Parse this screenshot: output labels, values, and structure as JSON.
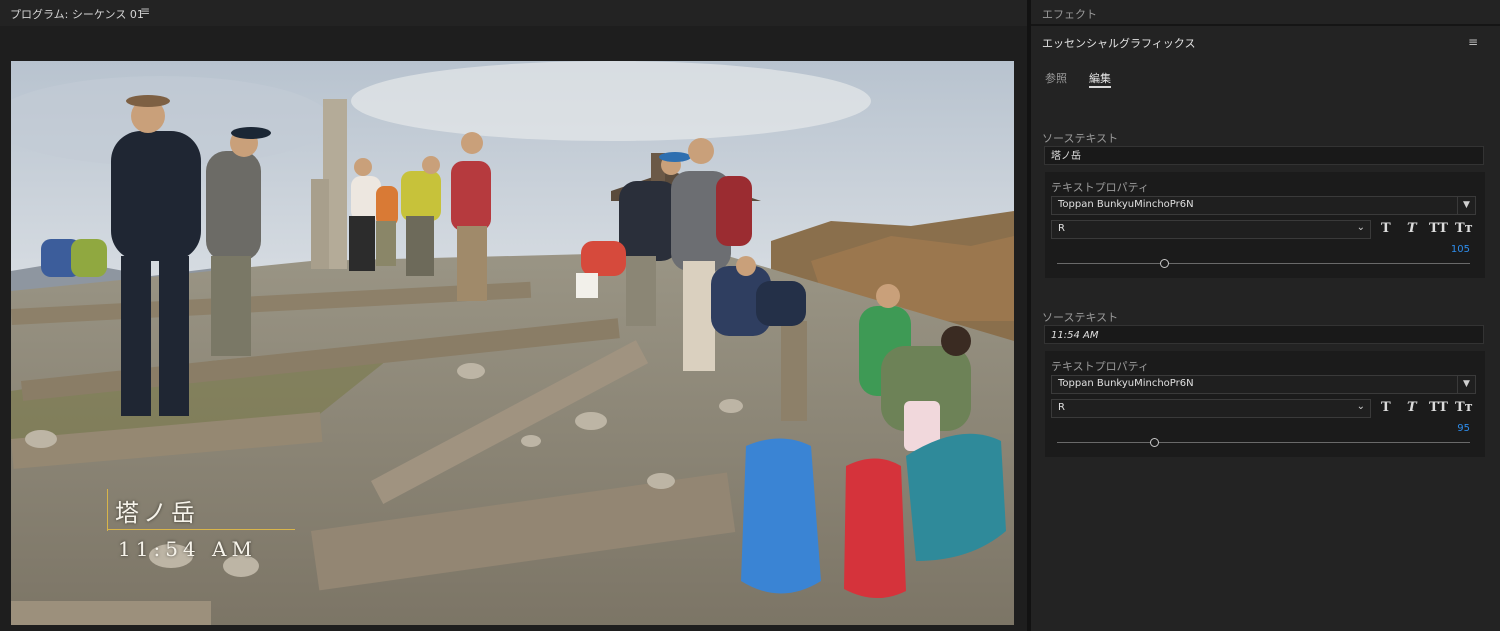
{
  "program": {
    "title": "プログラム: シーケンス 01",
    "menu_icon": "≡"
  },
  "overlay": {
    "place": "塔ノ岳",
    "time": "11:54 AM",
    "accent_color": "#d8b54a"
  },
  "panel": {
    "effects_label": "エフェクト",
    "title": "エッセンシャルグラフィックス",
    "menu_icon": "≡",
    "tabs": [
      "参照",
      "編集"
    ],
    "active_tab": "編集",
    "accent_color": "#2d8ceb",
    "layers": [
      {
        "source_label": "ソーステキスト",
        "source_text": "塔ノ岳",
        "props_label": "テキストプロパティ",
        "font": "Toppan BunkyuMinchoPr6N",
        "font_style": "R",
        "style_buttons": [
          "T",
          "T",
          "TT",
          "Tт"
        ],
        "font_size": "105",
        "slider_fraction": 0.26
      },
      {
        "source_label": "ソーステキスト",
        "source_text": "11:54 AM",
        "props_label": "テキストプロパティ",
        "font": "Toppan BunkyuMinchoPr6N",
        "font_style": "R",
        "style_buttons": [
          "T",
          "T",
          "TT",
          "Tт"
        ],
        "font_size": "95",
        "slider_fraction": 0.235
      }
    ]
  }
}
